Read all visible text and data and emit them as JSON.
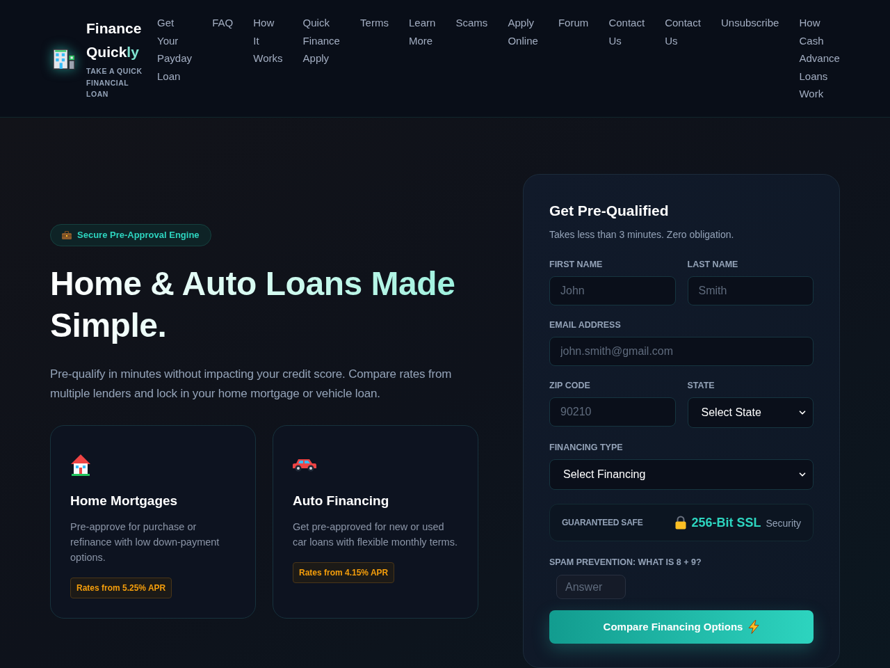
{
  "header": {
    "brand": {
      "name": "Finance Quick",
      "name_accent": "ly",
      "tagline": "TAKE A QUICK FINANCIAL LOAN"
    },
    "nav": [
      "Get Your Payday Loan",
      "FAQ",
      "How It Works",
      "Quick Finance Apply",
      "Terms",
      "Learn More",
      "Scams",
      "Apply Online",
      "Forum",
      "Contact Us",
      "Contact Us",
      "Unsubscribe",
      "How Cash Advance Loans Work"
    ]
  },
  "hero": {
    "badge": "Secure Pre-Approval Engine",
    "title": "Home & Auto Loans Made Simple.",
    "lead": "Pre-qualify in minutes without impacting your credit score. Compare rates from multiple lenders and lock in your home mortgage or vehicle loan.",
    "cards": [
      {
        "kind": "home",
        "title": "Home Mortgages",
        "text": "Pre-approve for purchase or refinance with low down-payment options.",
        "rate": "Rates from 5.25% APR"
      },
      {
        "kind": "auto",
        "title": "Auto Financing",
        "text": "Get pre-approved for new or used car loans with flexible monthly terms.",
        "rate": "Rates from 4.15% APR"
      }
    ]
  },
  "form": {
    "title": "Get Pre-Qualified",
    "subtitle": "Takes less than 3 minutes. Zero obligation.",
    "rows": [
      [
        {
          "kind": "input",
          "label": "FIRST NAME",
          "placeholder": "John"
        },
        {
          "kind": "input",
          "label": "LAST NAME",
          "placeholder": "Smith"
        }
      ],
      [
        {
          "kind": "input",
          "label": "EMAIL ADDRESS",
          "placeholder": "john.smith@gmail.com"
        }
      ],
      [
        {
          "kind": "input",
          "label": "ZIP CODE",
          "placeholder": "90210"
        },
        {
          "kind": "select",
          "label": "STATE",
          "value": "Select State"
        }
      ],
      [
        {
          "kind": "select",
          "label": "FINANCING TYPE",
          "value": "Select Financing"
        }
      ]
    ],
    "security": {
      "label": "GUARANTEED SAFE",
      "value": "256-Bit SSL",
      "suffix": "Security"
    },
    "spam": {
      "label": "SPAM PREVENTION: WHAT IS 8 + 9?",
      "placeholder": "Answer"
    },
    "submit": "Compare Financing Options"
  }
}
